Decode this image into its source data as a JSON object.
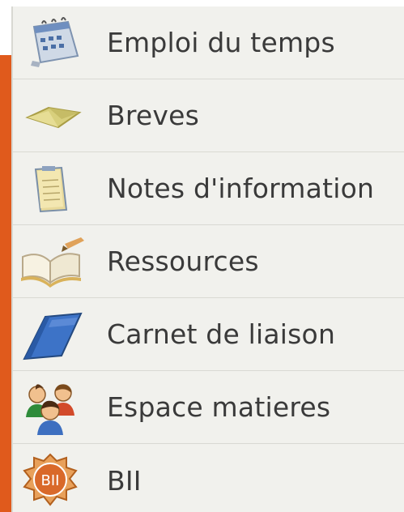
{
  "menu": {
    "accent_color": "#e05a1c",
    "items": [
      {
        "label": "Emploi du temps",
        "icon": "calendar-icon"
      },
      {
        "label": "Breves",
        "icon": "envelope-icon"
      },
      {
        "label": "Notes d'information",
        "icon": "notepad-icon"
      },
      {
        "label": "Ressources",
        "icon": "open-book-icon"
      },
      {
        "label": "Carnet de liaison",
        "icon": "notebook-icon"
      },
      {
        "label": "Espace matieres",
        "icon": "people-icon"
      },
      {
        "label": "BII",
        "icon": "badge-icon",
        "badge_text": "BII"
      }
    ]
  }
}
